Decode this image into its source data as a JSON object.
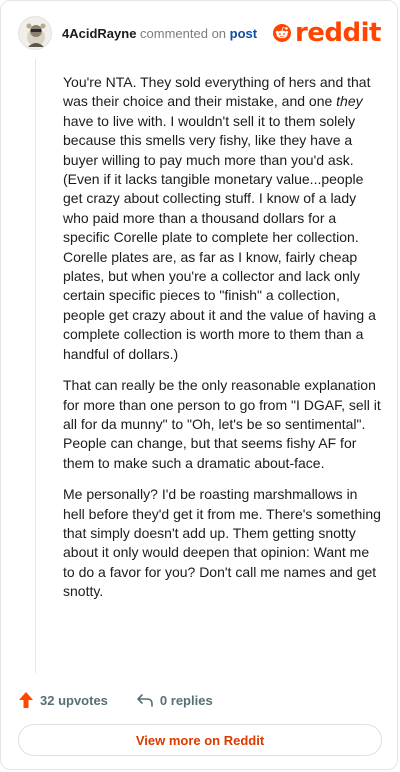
{
  "header": {
    "username": "4AcidRayne",
    "commented_text": " commented on ",
    "post_link": "post",
    "logo_text": "reddit",
    "brand_color": "#ff4500"
  },
  "comment": {
    "paragraphs": [
      {
        "before_em": "You're NTA. They sold everything of hers and that was their choice and their mistake, and one ",
        "em": "they",
        "after_em": " have to live with. I wouldn't sell it to them solely because this smells very fishy, like they have a buyer willing to pay much more than you'd ask. (Even if it lacks tangible monetary value...people get crazy about collecting stuff. I know of a lady who paid more than a thousand dollars for a specific Corelle plate to complete her collection. Corelle plates are, as far as I know, fairly cheap plates, but when you're a collector and lack only certain specific pieces to \"finish\" a collection, people get crazy about it and the value of having a complete collection is worth more to them than a handful of dollars.)"
      },
      {
        "text": "That can really be the only reasonable explanation for more than one person to go from \"I DGAF, sell it all for da munny\" to \"Oh, let's be so sentimental\". People can change, but that seems fishy AF for them to make such a dramatic about-face."
      },
      {
        "text": "Me personally? I'd be roasting marshmallows in hell before they'd get it from me. There's something that simply doesn't add up. Them getting snotty about it only would deepen that opinion: Want me to do a favor for you? Don't call me names and get snotty."
      }
    ]
  },
  "actions": {
    "upvotes_label": "32 upvotes",
    "replies_label": "0 replies",
    "upvote_icon": "upvote-arrow-icon",
    "reply_icon": "reply-arrow-icon",
    "upvote_color": "#ff4500"
  },
  "footer": {
    "view_more_label": "View more on Reddit"
  }
}
